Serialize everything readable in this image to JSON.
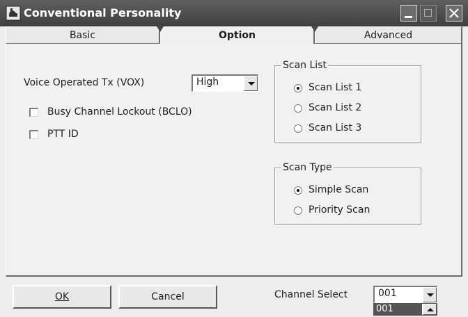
{
  "window": {
    "title": "Conventional Personality",
    "icon": "radio-app-icon",
    "controls": [
      "minimize-icon",
      "maximize-icon",
      "close-icon"
    ]
  },
  "tabs": [
    {
      "label": "Basic",
      "active": false
    },
    {
      "label": "Option",
      "active": true
    },
    {
      "label": "Advanced",
      "active": false
    }
  ],
  "options": {
    "vox_label": "Voice Operated Tx (VOX)",
    "vox_value": "High",
    "bclo_label": "Busy Channel Lockout (BCLO)",
    "bclo_checked": false,
    "pttid_label": "PTT ID",
    "pttid_checked": false
  },
  "scan_list": {
    "title": "Scan List",
    "items": [
      {
        "label": "Scan List 1",
        "selected": true
      },
      {
        "label": "Scan List 2",
        "selected": false
      },
      {
        "label": "Scan List 3",
        "selected": false
      }
    ]
  },
  "scan_type": {
    "title": "Scan Type",
    "items": [
      {
        "label": "Simple Scan",
        "selected": true
      },
      {
        "label": "Priority Scan",
        "selected": false
      }
    ]
  },
  "footer": {
    "ok_label": "OK",
    "cancel_label": "Cancel",
    "channel_select_label": "Channel Select",
    "channel_value": "001",
    "channel_dropdown_item": "001"
  },
  "colors": {
    "titlebar": "#4a4a4a",
    "panel": "#f1f1f1",
    "selection": "#555555"
  }
}
